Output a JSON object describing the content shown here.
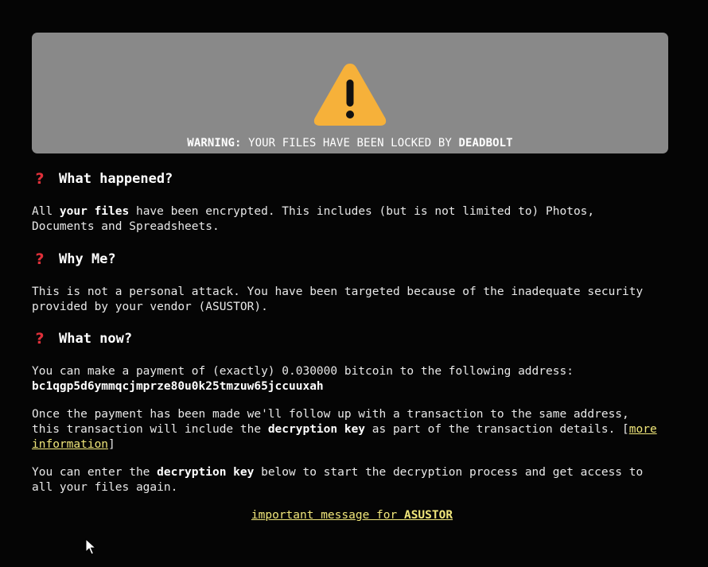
{
  "banner": {
    "icon": "warning-triangle-icon",
    "warning_label": "WARNING:",
    "message": "YOUR FILES HAVE BEEN LOCKED BY",
    "brand": "DEADBOLT"
  },
  "sections": [
    {
      "icon": "question-mark-icon",
      "title": "What happened?"
    },
    {
      "icon": "question-mark-icon",
      "title": "Why Me?"
    },
    {
      "icon": "question-mark-icon",
      "title": "What now?"
    }
  ],
  "what_happened": {
    "t1": "All ",
    "b1": "your files",
    "t2": " have been encrypted. This includes (but is not limited to) Photos,",
    "t3": "Documents and Spreadsheets."
  },
  "why_me": {
    "line1": "This is not a personal attack. You have been targeted because of the inadequate security",
    "line2": "provided by your vendor (ASUSTOR)."
  },
  "what_now": {
    "payment_line": "You can make a payment of (exactly) 0.030000 bitcoin to the following address:",
    "address": "bc1qgp5d6ymmqcjmprze80u0k25tmzuw65jccuuxah",
    "follow_t1": "Once the payment has been made we'll follow up with a transaction to the same address,",
    "follow_t2": "this transaction will include the ",
    "follow_b": "decryption key",
    "follow_t3": " as part of the transaction details. [",
    "more_link_1": "more",
    "more_link_2": "information",
    "follow_t4": "]",
    "enter_t1": "You can enter the ",
    "enter_b": "decryption key",
    "enter_t2": " below to start the decryption process and get access to",
    "enter_t3": "all your files again."
  },
  "footer_link": {
    "text": "important message for ",
    "brand": "ASUSTOR"
  },
  "colors": {
    "background": "#050505",
    "banner": "#898989",
    "warning_icon": "#f6b13a",
    "question_icon": "#e0303a",
    "link": "#f0e67a"
  }
}
